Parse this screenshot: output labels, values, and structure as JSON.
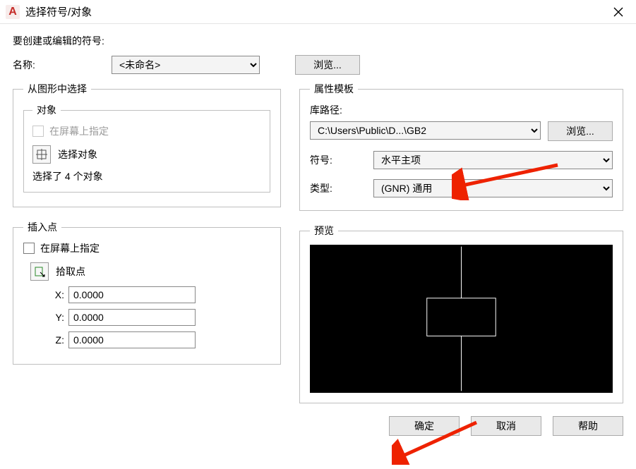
{
  "titlebar": {
    "app_icon": "A",
    "title": "选择符号/对象"
  },
  "prompt": "要创建或编辑的符号:",
  "name_row": {
    "label": "名称:",
    "value": "<未命名>",
    "browse_label": "浏览..."
  },
  "from_drawing": {
    "legend": "从图形中选择",
    "objects": {
      "legend": "对象",
      "specify_on_screen": "在屏幕上指定",
      "select_objects": "选择对象",
      "status": "选择了 4 个对象"
    },
    "insertion": {
      "legend": "插入点",
      "specify_on_screen": "在屏幕上指定",
      "pick_point": "拾取点",
      "x_label": "X:",
      "y_label": "Y:",
      "z_label": "Z:",
      "x": "0.0000",
      "y": "0.0000",
      "z": "0.0000"
    }
  },
  "prop_template": {
    "legend": "属性模板",
    "lib_path_label": "库路径:",
    "lib_path": "C:\\Users\\Public\\D...\\GB2",
    "browse_label": "浏览...",
    "symbol_label": "符号:",
    "symbol_value": "水平主项",
    "type_label": "类型:",
    "type_value": "(GNR) 通用"
  },
  "preview": {
    "legend": "预览"
  },
  "buttons": {
    "ok": "确定",
    "cancel": "取消",
    "help": "帮助"
  }
}
